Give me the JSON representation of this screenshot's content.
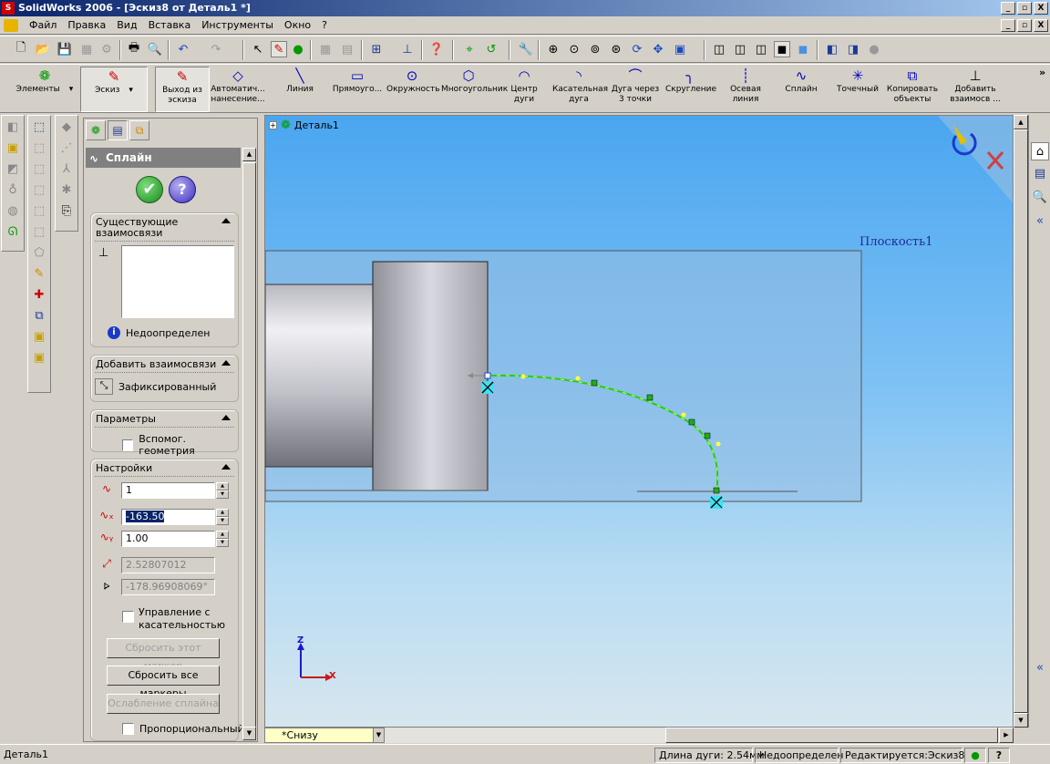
{
  "window": {
    "title": "SolidWorks 2006 - [Эскиз8 от Деталь1 *]",
    "app_icon": "S",
    "controls": [
      "_",
      "▫",
      "X"
    ]
  },
  "menu": {
    "items": [
      "Файл",
      "Правка",
      "Вид",
      "Вставка",
      "Инструменты",
      "Окно",
      "?"
    ]
  },
  "command_manager": {
    "tabs": [
      {
        "label": "Элементы"
      },
      {
        "label": "Эскиз"
      }
    ],
    "tools": [
      {
        "label": "Выход из эскиза",
        "icon": "exit-sketch-icon"
      },
      {
        "label": "Автоматич... нанесение...",
        "icon": "smart-dimension-icon"
      },
      {
        "label": "Линия",
        "icon": "line-icon"
      },
      {
        "label": "Прямоуго...",
        "icon": "rectangle-icon"
      },
      {
        "label": "Окружность",
        "icon": "circle-icon"
      },
      {
        "label": "Многоугольник",
        "icon": "polygon-icon"
      },
      {
        "label": "Центр дуги",
        "icon": "centerpoint-arc-icon"
      },
      {
        "label": "Касательная дуга",
        "icon": "tangent-arc-icon"
      },
      {
        "label": "Дуга через 3 точки",
        "icon": "3point-arc-icon"
      },
      {
        "label": "Скругление",
        "icon": "fillet-icon"
      },
      {
        "label": "Осевая линия",
        "icon": "centerline-icon"
      },
      {
        "label": "Сплайн",
        "icon": "spline-icon"
      },
      {
        "label": "Точечный",
        "icon": "point-icon"
      },
      {
        "label": "Копировать объекты",
        "icon": "copy-entities-icon"
      },
      {
        "label": "Добавить взаимосв ...",
        "icon": "add-relation-icon"
      }
    ],
    "more": "»"
  },
  "property_manager": {
    "title": "Сплайн",
    "ok_glyph": "✔",
    "help_glyph": "?",
    "existing_relations": {
      "title_line1": "Существующие",
      "title_line2": "взаимосвязи",
      "status": "Недоопределен",
      "info_glyph": "i"
    },
    "add_relations": {
      "title": "Добавить взаимосвязи",
      "item": "Зафиксированный"
    },
    "parameters": {
      "title": "Параметры",
      "construction_label": "Вспомог. геометрия"
    },
    "settings": {
      "title": "Настройки",
      "point_number": "1",
      "x_value": "-163.50",
      "y_value": "1.00",
      "tangent_weight": "2.52807012",
      "tangent_angle": "-178.96908069°",
      "tangent_control_line1": "Управление с",
      "tangent_control_line2": "касательностью",
      "reset_this": "Сбросить этот маркер",
      "reset_all": "Сбросить все маркеры",
      "relax": "Ослабление сплайна",
      "proportional": "Пропорциональный"
    }
  },
  "viewport": {
    "tree_root": "Деталь1",
    "plane_label": "Плоскость1",
    "triad": {
      "z": "Z",
      "x": "X"
    },
    "view_orientation": "*Снизу",
    "spline_color": "#22cc22",
    "background_top": "#4aa6f0"
  },
  "status": {
    "doc": "Деталь1",
    "arc_length": "Длина дуги: 2.54мм",
    "defined": "Недоопределен",
    "editing": "Редактируется:Эскиз8",
    "help": "?"
  }
}
